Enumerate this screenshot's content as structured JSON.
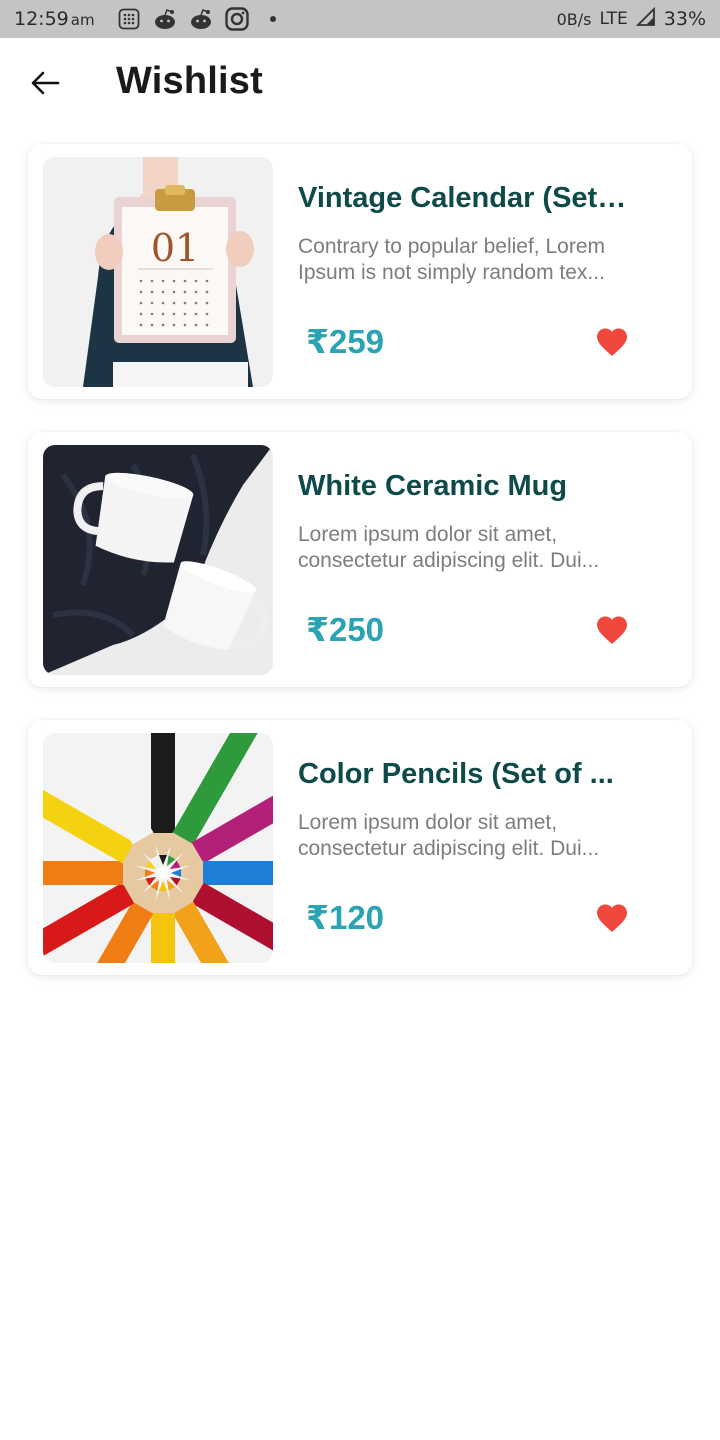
{
  "status_bar": {
    "time": "12:59",
    "ampm": "am",
    "icons": [
      "calculator-icon",
      "reddit-icon",
      "reddit-icon",
      "instagram-icon",
      "dot-icon"
    ],
    "net_speed": "0B/s",
    "network": "LTE",
    "battery": "33%"
  },
  "header": {
    "title": "Wishlist",
    "back_icon": "arrow-left-icon"
  },
  "colors": {
    "title": "#0f4a4a",
    "price": "#2aa3b3",
    "heart": "#f0483e",
    "desc": "#7d7d7d"
  },
  "items": [
    {
      "title": "Vintage Calendar (Set ...",
      "description": "Contrary to popular belief, Lorem Ipsum is not simply random tex...",
      "price": "₹259",
      "image": "calendar-photo",
      "favorite_icon": "heart-icon",
      "calendar_number": "01"
    },
    {
      "title": "White Ceramic Mug",
      "description": "Lorem ipsum dolor sit amet, consectetur adipiscing elit. Dui...",
      "price": "₹250",
      "image": "mugs-photo",
      "favorite_icon": "heart-icon"
    },
    {
      "title": "Color Pencils (Set of ...",
      "description": "Lorem ipsum dolor sit amet, consectetur adipiscing elit. Dui...",
      "price": "₹120",
      "image": "pencils-photo",
      "favorite_icon": "heart-icon"
    }
  ]
}
